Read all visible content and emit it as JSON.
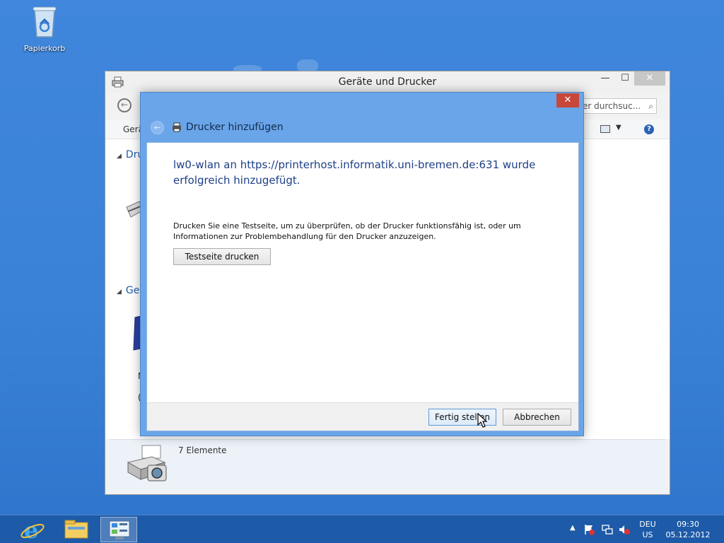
{
  "desktop": {
    "icons": [
      {
        "label": "Papierkorb",
        "icon": "recycle-bin-icon"
      }
    ]
  },
  "explorer": {
    "title": "Geräte und Drucker",
    "search_placeholder": "er durchsuc...",
    "toolbar_label": "Gerä",
    "section1_label": "Dru",
    "section2_label": "Ger",
    "fragment_m": "M",
    "fragment_paren": "(",
    "status_count": "7 Elemente",
    "window_buttons": {
      "minimize": "—",
      "maximize": "☐",
      "close": "✕"
    }
  },
  "dialog": {
    "title": "Drucker hinzufügen",
    "close": "✕",
    "message": "lw0-wlan an https://printerhost.informatik.uni-bremen.de:631 wurde erfolgreich hinzugefügt.",
    "info": "Drucken Sie eine Testseite, um zu überprüfen, ob der Drucker funktionsfähig ist, oder um Informationen zur Problembehandlung für den Drucker anzuzeigen.",
    "test_button": "Testseite drucken",
    "finish_button": "Fertig stellen",
    "cancel_button": "Abbrechen"
  },
  "taskbar": {
    "pinned": [
      {
        "icon": "internet-explorer-icon"
      },
      {
        "icon": "file-explorer-icon"
      },
      {
        "icon": "control-panel-icon",
        "active": true
      }
    ],
    "tray_icons": [
      "action-center-flag-icon",
      "network-icon",
      "volume-muted-icon"
    ],
    "lang_top": "DEU",
    "lang_bottom": "US",
    "time": "09:30",
    "date": "05.12.2012"
  },
  "colors": {
    "desktop": "#3a82d8",
    "dialog_frame": "#6aa5e9",
    "message_text": "#1e3f87",
    "taskbar": "#1d5aa8",
    "close_red": "#c7483b"
  }
}
